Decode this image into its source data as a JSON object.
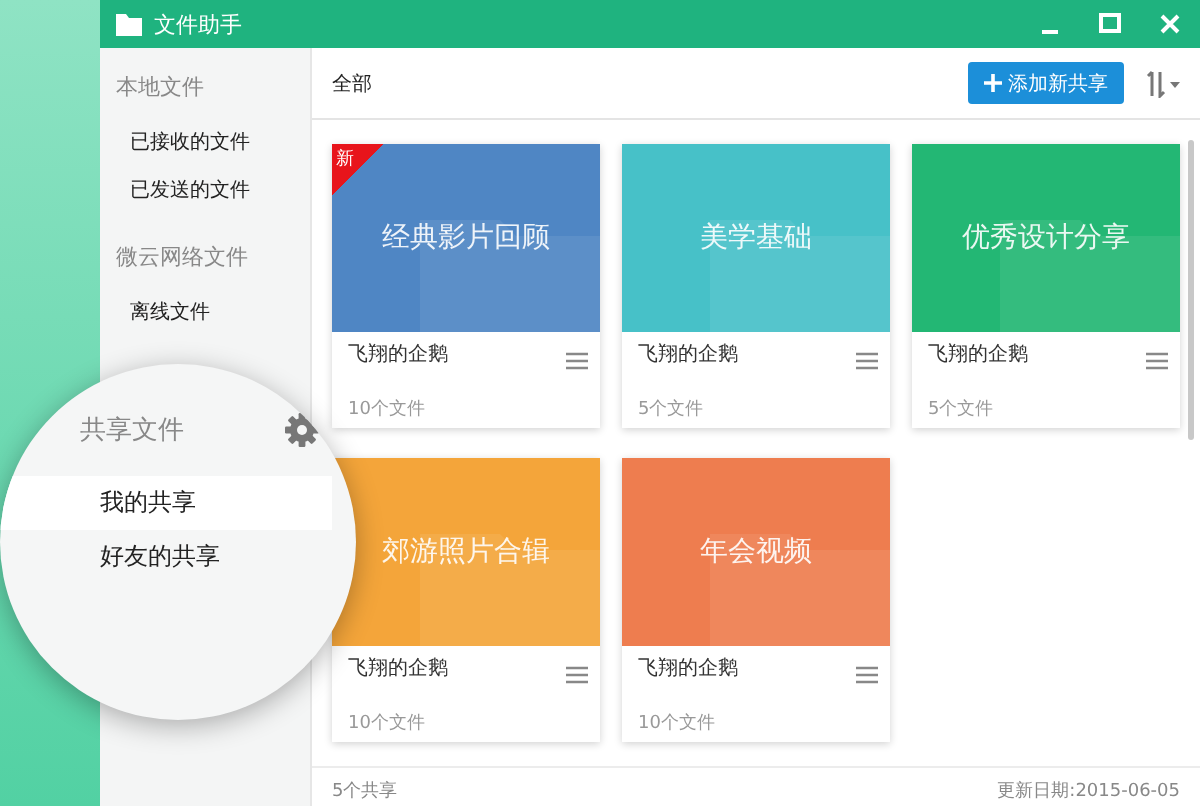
{
  "window": {
    "title": "文件助手"
  },
  "sidebar": {
    "sections": [
      {
        "heading": "本地文件",
        "items": [
          {
            "label": "已接收的文件"
          },
          {
            "label": "已发送的文件"
          }
        ]
      },
      {
        "heading": "微云网络文件",
        "items": [
          {
            "label": "离线文件"
          }
        ]
      }
    ]
  },
  "magnifier": {
    "heading": "共享文件",
    "items": [
      {
        "label": "我的共享",
        "selected": true
      },
      {
        "label": "好友的共享",
        "selected": false
      }
    ]
  },
  "toolbar": {
    "filter": "全部",
    "add_button": "添加新共享"
  },
  "cards": [
    {
      "title": "经典影片回顾",
      "owner": "飞翔的企鹅",
      "count": "10个文件",
      "color": "#4f86c4",
      "badge": "新"
    },
    {
      "title": "美学基础",
      "owner": "飞翔的企鹅",
      "count": "5个文件",
      "color": "#47c1c8"
    },
    {
      "title": "优秀设计分享",
      "owner": "飞翔的企鹅",
      "count": "5个文件",
      "color": "#23b774"
    },
    {
      "title": "郊游照片合辑",
      "owner": "飞翔的企鹅",
      "count": "10个文件",
      "color": "#f4a53a"
    },
    {
      "title": "年会视频",
      "owner": "飞翔的企鹅",
      "count": "10个文件",
      "color": "#ee7d4f"
    }
  ],
  "status_bar": {
    "total": "5个共享",
    "updated": "更新日期:2015-06-05"
  }
}
